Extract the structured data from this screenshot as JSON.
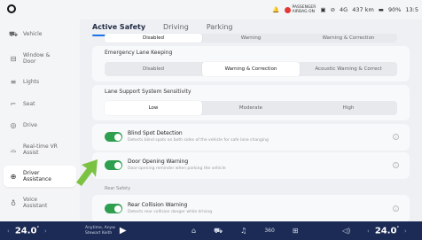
{
  "statusbar": {
    "passenger_airbag_line1": "PASSENGER",
    "passenger_airbag_line2": "AIRBAG ON",
    "signal": "4G",
    "range": "437 km",
    "battery": "90%",
    "time": "13:5"
  },
  "sidebar": {
    "items": [
      {
        "label": "Vehicle",
        "icon": "car-icon"
      },
      {
        "label": "Window & Door",
        "icon": "window-icon"
      },
      {
        "label": "Lights",
        "icon": "lights-icon"
      },
      {
        "label": "Seat",
        "icon": "seat-icon"
      },
      {
        "label": "Drive",
        "icon": "steering-wheel-icon"
      },
      {
        "label": "Real-time VR Assist",
        "icon": "vr-icon"
      },
      {
        "label": "Driver Assistance",
        "icon": "driver-assist-icon"
      },
      {
        "label": "Voice Assistant",
        "icon": "voice-icon"
      }
    ]
  },
  "tabs": [
    "Active Safety",
    "Driving",
    "Parking"
  ],
  "first_row": {
    "options": [
      "Disabled",
      "Warning",
      "Warning & Correction"
    ]
  },
  "lane_keeping": {
    "title": "Emergency Lane Keeping",
    "options": [
      "Disabled",
      "Warning & Correction",
      "Acoustic Warning & Correct"
    ],
    "selected": 1
  },
  "sensitivity": {
    "title": "Lane Support System Sensitivity",
    "options": [
      "Low",
      "Moderate",
      "High"
    ],
    "selected": 0
  },
  "toggles": [
    {
      "title": "Blind Spot Detection",
      "desc": "Detects blind spots on both sides of the vehicle for safe lane changing",
      "on": true
    },
    {
      "title": "Door Opening Warning",
      "desc": "Door-opening reminder when parking the vehicle",
      "on": true
    }
  ],
  "rear_safety": {
    "title": "Rear Safety",
    "toggle": {
      "title": "Rear Collision Warning",
      "desc": "Detects rear collision danger while driving",
      "on": true
    }
  },
  "bottombar": {
    "temp_left": "24.0",
    "temp_right": "24.0",
    "unit": "°",
    "media_line1": "Anytime, Anyw",
    "media_line2": "Stewart Keith",
    "nav_icons": [
      "home-icon",
      "car-icon",
      "music-icon",
      "360-icon",
      "apps-icon"
    ],
    "center_360": "360"
  },
  "colors": {
    "accent": "#1a73e8",
    "toggle_on": "#2e9e4f",
    "bottom_bar": "#1c2b55",
    "arrow": "#7cc242"
  }
}
